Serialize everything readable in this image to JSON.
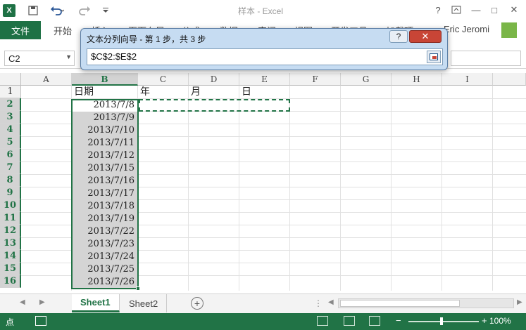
{
  "titlebar": {
    "title": "样本 - Excel",
    "undo_icon": "undo-icon",
    "redo_icon": "redo-icon",
    "save_icon": "save-icon",
    "help": "?",
    "minimize": "—",
    "maximize": "□",
    "close": "✕"
  },
  "ribbon": {
    "file_tab": "文件",
    "tabs": [
      "开始",
      "插入",
      "页面布局",
      "公式",
      "数据",
      "审阅",
      "视图",
      "开发工具",
      "加载项"
    ],
    "user": "Eric Jeromi"
  },
  "name_box": {
    "value": "C2"
  },
  "columns": [
    "A",
    "B",
    "C",
    "D",
    "E",
    "F",
    "G",
    "H",
    "I"
  ],
  "rows": [
    "1",
    "2",
    "3",
    "4",
    "5",
    "6",
    "7",
    "8",
    "9",
    "10",
    "11",
    "12",
    "13",
    "14",
    "15",
    "16"
  ],
  "headers": {
    "B1": "日期",
    "C1": "年",
    "D1": "月",
    "E1": "日"
  },
  "dates": [
    "2013/7/8",
    "2013/7/9",
    "2013/7/10",
    "2013/7/11",
    "2013/7/12",
    "2013/7/15",
    "2013/7/16",
    "2013/7/17",
    "2013/7/18",
    "2013/7/19",
    "2013/7/22",
    "2013/7/23",
    "2013/7/24",
    "2013/7/25",
    "2013/7/26"
  ],
  "dialog": {
    "title": "文本分列向导 - 第 1 步，共 3 步",
    "help": "?",
    "close": "✕",
    "value": "$C$2:$E$2"
  },
  "sheets": [
    "Sheet1",
    "Sheet2"
  ],
  "add_sheet": "+",
  "status": {
    "ready": "点",
    "zoom": "100%"
  },
  "colors": {
    "excel_green": "#217346",
    "selection_fill": "#d4d4d4",
    "dialog_bg": "#c6dcf2",
    "close_red": "#c84536"
  }
}
